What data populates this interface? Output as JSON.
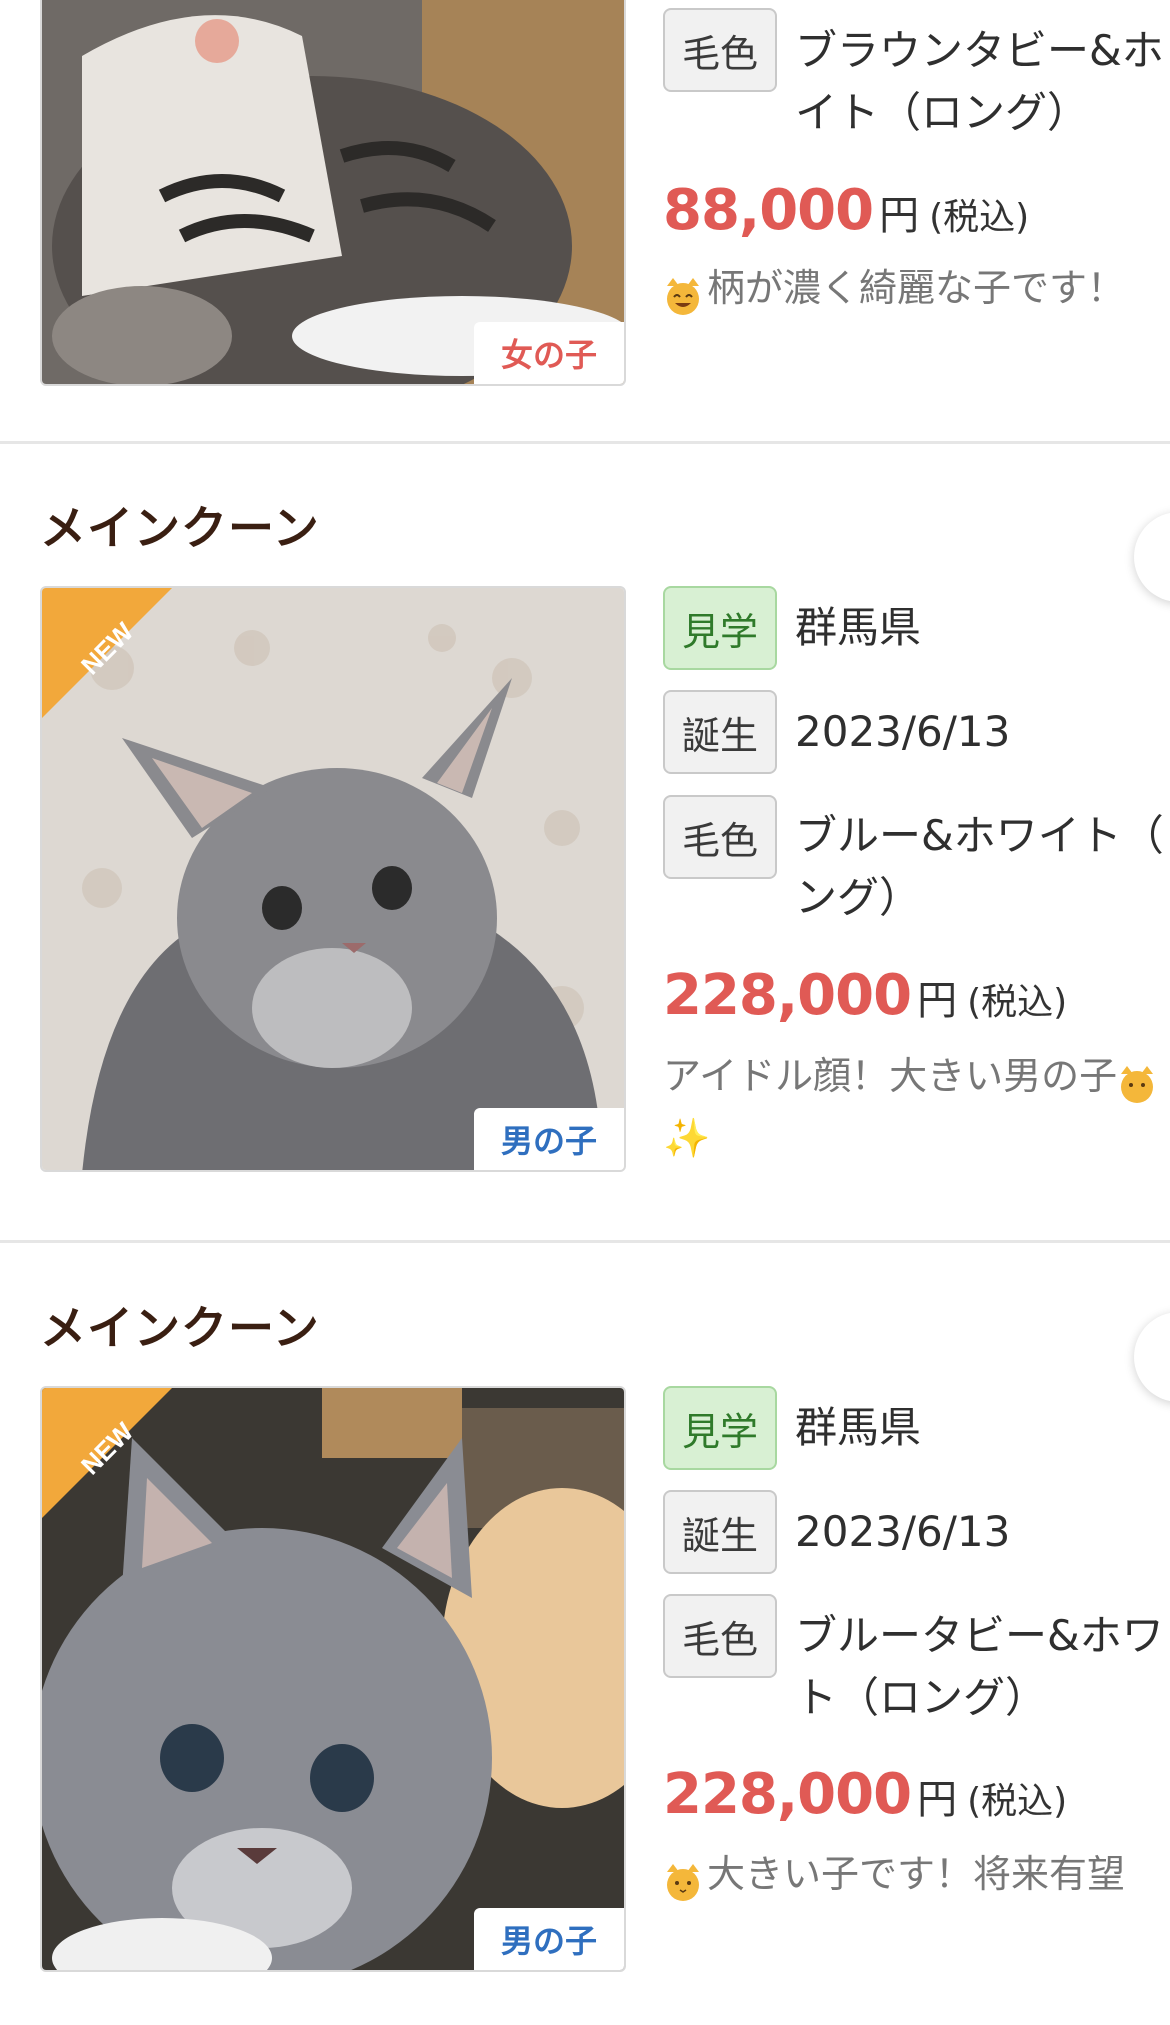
{
  "listing1": {
    "sex": "女の子",
    "coat_label": "毛色",
    "coat_line1": "ブラウンタビー&ホ",
    "coat_line2": "イト（ロング）",
    "price": "88,000",
    "price_unit": "円",
    "price_tax": "(税込)",
    "comment": "柄が濃く綺麗な子です！"
  },
  "listing2": {
    "breed": "メインクーン",
    "new_label": "NEW",
    "sex": "男の子",
    "visit_label": "見学",
    "location": "群馬県",
    "birth_label": "誕生",
    "birth": "2023/6/13",
    "coat_label": "毛色",
    "coat_line1": "ブルー&ホワイト（",
    "coat_line2": "ング）",
    "price": "228,000",
    "price_unit": "円",
    "price_tax": "(税込)",
    "comment_line1": "アイドル顔！大きい男の子",
    "comment_line2": "✨"
  },
  "listing3": {
    "breed": "メインクーン",
    "new_label": "NEW",
    "sex": "男の子",
    "visit_label": "見学",
    "location": "群馬県",
    "birth_label": "誕生",
    "birth": "2023/6/13",
    "coat_label": "毛色",
    "coat_line1": "ブルータビー&ホワ",
    "coat_line2": "ト（ロング）",
    "price": "228,000",
    "price_unit": "円",
    "price_tax": "(税込)",
    "comment": "大きい子です！将来有望"
  },
  "colors": {
    "price": "#e05a55",
    "female": "#e05a55",
    "male": "#2f6fbf",
    "new_ribbon": "#f2a83b",
    "visit_tag_bg": "#d8f0d3"
  }
}
